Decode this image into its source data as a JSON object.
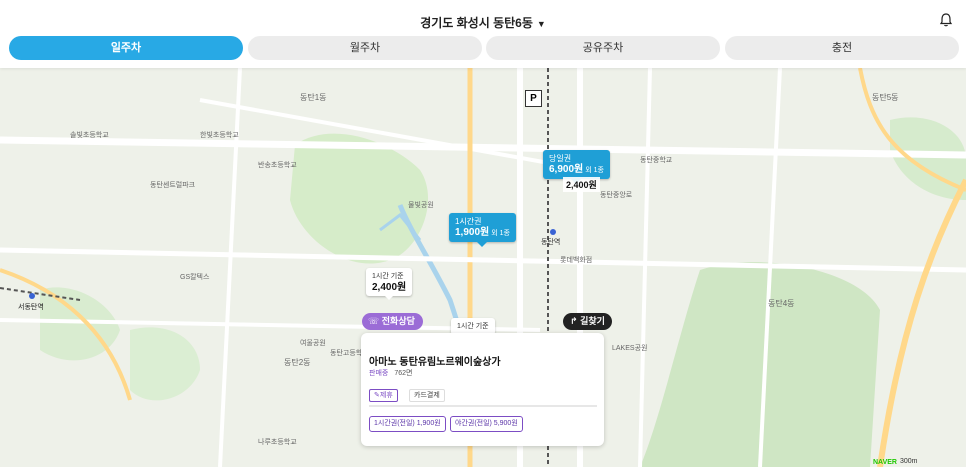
{
  "header": {
    "location": "경기도 화성시 동탄6동"
  },
  "tabs": [
    {
      "label": "일주차",
      "active": true
    },
    {
      "label": "월주차",
      "active": false
    },
    {
      "label": "공유주차",
      "active": false
    },
    {
      "label": "충전",
      "active": false
    }
  ],
  "map": {
    "labels": [
      "동탄5동",
      "동탄4동",
      "동탄1동",
      "동탄2동",
      "동탄역",
      "동탄중앙로",
      "반송초등학교",
      "동탄고등학교",
      "동탄중학교",
      "한빛초등학교",
      "솔빛초등학교",
      "서동탄역",
      "GS칼텍스",
      "LAKES공원",
      "롯데백화점",
      "나루초등학교",
      "물빛공원",
      "여울공원",
      "동탄센트럴파크"
    ],
    "pins": [
      {
        "kind": "blue",
        "label": "당일권",
        "price": "6,900원",
        "unit": "외 1종"
      },
      {
        "kind": "blue",
        "label": "1시간권",
        "price": "1,900원",
        "unit": "외 1종"
      },
      {
        "kind": "plain",
        "price": "2,400원"
      },
      {
        "kind": "white",
        "label": "1시간 기준",
        "price": "2,400원"
      },
      {
        "kind": "white",
        "label": "1시간 기준",
        "price": ""
      }
    ],
    "p_icon": "P",
    "scale": "300m",
    "naver": "NAVER"
  },
  "actions": {
    "phone": "전화상담",
    "route": "길찾기"
  },
  "card": {
    "title": "아마노 동탄유림노르웨이숲상가",
    "type": "판매중",
    "spots": "762면",
    "tag1": "제휴",
    "tag2": "카드결제",
    "ticket1": "1시간권(전일) 1,900원",
    "ticket2": "야간권(전일) 5,900원"
  },
  "colors": {
    "primary": "#28a9e5",
    "pin": "#1f9fd6",
    "accent": "#7c4dc4"
  }
}
